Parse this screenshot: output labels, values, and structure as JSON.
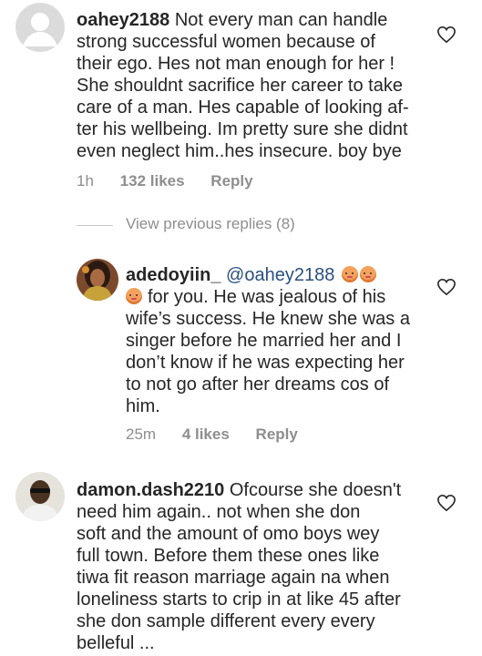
{
  "comments": [
    {
      "username": "oahey2188",
      "text": "Not every man can handle strong successful women because of their ego. Hes not man enough for her ! She shouldnt sacrifice her career to take care of a man. Hes capable of looking af- ter his wellbeing. Im pretty sure she didnt even neglect him..hes insecure. boy bye",
      "lines": [
        "Not every man can handle",
        "strong successful women because of",
        "their ego. Hes not man enough for her !",
        "She shouldnt sacrifice her career to take",
        "care of a man. Hes capable of looking af-",
        "ter his wellbeing. Im pretty sure she didnt",
        "even neglect him..hes insecure. boy bye"
      ],
      "time": "1h",
      "likes": "132 likes",
      "reply": "Reply"
    },
    {
      "view_replies": "View previous replies (8)"
    },
    {
      "username": "adedoyiin_",
      "mention": "@oahey2188",
      "lines": [
        "for you. He was jealous of his",
        "wife’s success. He knew she was a",
        "singer before he married her and I",
        "don’t know if he was expecting her",
        "to not go after her dreams cos of",
        "him."
      ],
      "time": "25m",
      "likes": "4 likes",
      "reply": "Reply"
    },
    {
      "username": "damon.dash2210",
      "lines": [
        "Ofcourse she doesn't",
        "need him again.. not when she don",
        "soft and the amount of omo boys wey",
        "full town. Before them these ones like",
        "tiwa fit reason marriage again na when",
        "loneliness starts to crip in at like 45 after",
        "she don sample different every every",
        "belleful ..."
      ]
    }
  ],
  "icons": {
    "heart": "heart-outline-icon",
    "default_avatar": "default-user-avatar"
  },
  "colors": {
    "text": "#262626",
    "meta": "#8e8e8e",
    "mention": "#2a4f7f"
  }
}
